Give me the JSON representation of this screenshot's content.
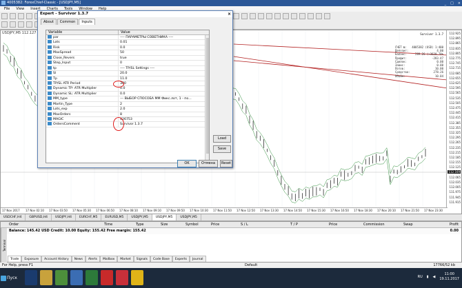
{
  "window": {
    "title": "4005382: ForexChief-Classic - [USDJPY,M5]",
    "controls": [
      "_",
      "□",
      "×"
    ]
  },
  "menu": [
    "File",
    "View",
    "Insert",
    "Charts",
    "Tools",
    "Window",
    "Help"
  ],
  "chart": {
    "header": "USDJPY,M5 112.127 112.",
    "ea_name": "Survivor 1.3.7",
    "account": [
      [
        "СЧЕТ №:",
        "4005382 (USD) 1:400"
      ],
      [
        "Депозит:",
        "4.00"
      ],
      [
        "Баланс:",
        "289.26 (+3620.70%"
      ],
      [
        "Профит:",
        "-283.47"
      ],
      [
        "Сделок:",
        "0.00"
      ],
      [
        "Завис:",
        "0.00"
      ],
      [
        "Лотов:",
        "10.00"
      ],
      [
        "Средства:",
        "278.26"
      ],
      [
        "Объём:",
        "10.04"
      ]
    ],
    "prices": [
      "112.925",
      "112.895",
      "112.865",
      "112.835",
      "112.805",
      "112.775",
      "112.745",
      "112.715",
      "112.685",
      "112.655",
      "112.625",
      "112.595",
      "112.565",
      "112.535",
      "112.505",
      "112.475",
      "112.445",
      "112.415",
      "112.385",
      "112.355",
      "112.325",
      "112.295",
      "112.265",
      "112.235",
      "112.215",
      "112.185",
      "112.155",
      "112.125",
      "112.095",
      "112.065",
      "112.035",
      "112.005",
      "111.975",
      "111.945",
      "111.915"
    ],
    "current_price": "112.169",
    "times": [
      "17 Nov 2017",
      "17 Nov 02:10",
      "17 Nov 03:50",
      "17 Nov 05:30",
      "17 Nov 06:50",
      "17 Nov 08:10",
      "17 Nov 09:10",
      "17 Nov 09:50",
      "17 Nov 10:30",
      "17 Nov 11:50",
      "17 Nov 12:50",
      "17 Nov 13:30",
      "17 Nov 14:50",
      "17 Nov 15:30",
      "17 Nov 16:50",
      "17 Nov 18:30",
      "17 Nov 20:10",
      "17 Nov 21:50",
      "17 Nov 23:30"
    ]
  },
  "chart_tabs": [
    "USDCHF,H4",
    "GBPUSD,H4",
    "USDJPY,H4",
    "EURCHF,M5",
    "EURUSD,M5",
    "USDJPY,M5",
    "USDJPY,M5",
    "USDJPY,M5"
  ],
  "dialog": {
    "title": "Expert - Survivor 1.3.7",
    "close": "×",
    "tabs": [
      "About",
      "Common",
      "Inputs"
    ],
    "col_variable": "Variable",
    "col_value": "Value",
    "params": [
      [
        "par",
        "---- ПАРАМЕТРЫ СОВЕТНИКА ----"
      ],
      [
        "Lots",
        "0.01"
      ],
      [
        "Risk",
        "0.0"
      ],
      [
        "MaxSpread",
        "50"
      ],
      [
        "Close_Revers",
        "true"
      ],
      [
        "Step_Input",
        "0"
      ],
      [
        "tp",
        "---- TP/SL Settings ----"
      ],
      [
        "Sl",
        "20.0"
      ],
      [
        "Tp",
        "11.0"
      ],
      [
        "TP/SL ATR Period",
        "300"
      ],
      [
        "Dynamic TP: ATR Multiplier",
        "0.0"
      ],
      [
        "Dynamic SL: ATR Multiplier",
        "0.0"
      ],
      [
        "MM_type",
        "--- ВЫБОР СПОСОБА ММ Фикс.лот, 1 - по..."
      ],
      [
        "Martin_Type",
        "2"
      ],
      [
        "Lots_exp",
        "2.0"
      ],
      [
        "MaxOrders",
        "8"
      ],
      [
        "MAGIC",
        "426753"
      ],
      [
        "OrdersComment",
        "Survivor 1.3.7"
      ]
    ],
    "btn_load": "Load",
    "btn_save": "Save",
    "btn_ok": "OK",
    "btn_cancel": "Отмена",
    "btn_reset": "Reset"
  },
  "terminal": {
    "side_label": "Terminal",
    "columns": [
      "Order",
      "Time",
      "Type",
      "Size",
      "Symbol",
      "Price",
      "S / L",
      "T / P",
      "Price",
      "Commission",
      "Swap",
      "Profit"
    ],
    "balance_line": "Balance: 145.42 USD  Credit: 10.00  Equity: 155.42  Free margin: 155.42",
    "profit": "0.00",
    "tabs": [
      "Trade",
      "Exposure",
      "Account History",
      "News",
      "Alerts",
      "Mailbox",
      "Market",
      "Signals",
      "Code Base",
      "Experts",
      "Journal"
    ]
  },
  "status": {
    "left": "For Help, press F1",
    "mid": "Default",
    "right": "17766/52 kb"
  },
  "taskbar": {
    "start": "Пуск",
    "lang": "RU",
    "time": "11:00",
    "date": "19.11.2017"
  },
  "colors": {
    "accent": "#2b5797",
    "highlight": "#e01818",
    "ma_red": "#b21e1e",
    "ma_green": "#2f8f3a"
  }
}
